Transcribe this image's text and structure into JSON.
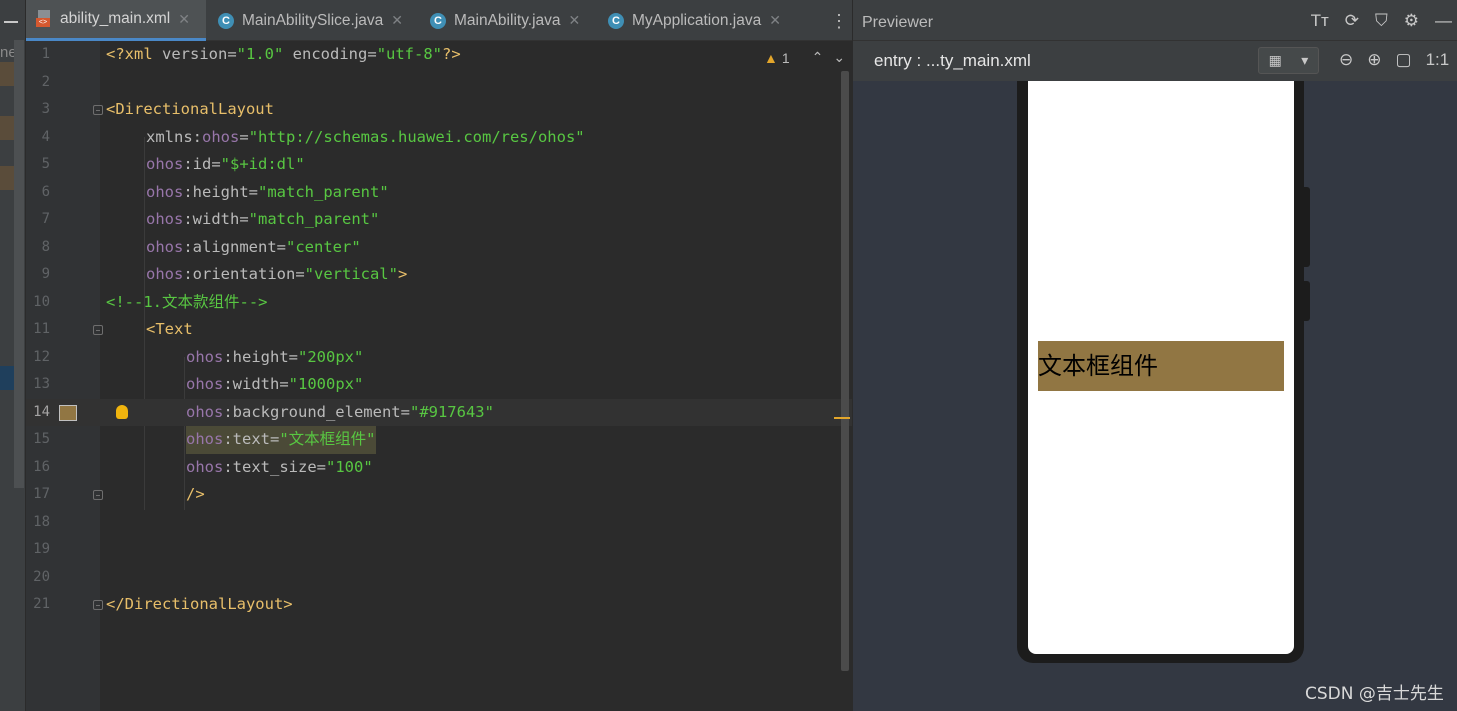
{
  "left_strip": {
    "cut_text": "ner"
  },
  "tabs": [
    {
      "label": "ability_main.xml",
      "icon": "xml-file-icon",
      "active": true
    },
    {
      "label": "MainAbilitySlice.java",
      "icon": "class-icon",
      "active": false
    },
    {
      "label": "MainAbility.java",
      "icon": "class-icon",
      "active": false
    },
    {
      "label": "MyApplication.java",
      "icon": "class-icon",
      "active": false
    }
  ],
  "tab_close": "✕",
  "more_menu": "⋮",
  "inspection": {
    "warnings": "1"
  },
  "line_numbers": [
    "1",
    "2",
    "3",
    "4",
    "5",
    "6",
    "7",
    "8",
    "9",
    "10",
    "11",
    "12",
    "13",
    "14",
    "15",
    "16",
    "17",
    "18",
    "19",
    "20",
    "21"
  ],
  "code": {
    "l1_a": "<?xml ",
    "l1_b": "version",
    "l1_c": "=",
    "l1_d": "\"1.0\"",
    "l1_e": " encoding",
    "l1_f": "=",
    "l1_g": "\"utf-8\"",
    "l1_h": "?>",
    "l3": "<DirectionalLayout",
    "l4_a": "xmlns",
    "l4_b": ":",
    "l4_c": "ohos",
    "l4_d": "=",
    "l4_e": "\"http://schemas.huawei.com/res/ohos\"",
    "ns": "ohos",
    "l5_b": ":id",
    "l5_c": "=",
    "l5_d": "\"$+id:dl\"",
    "l6_b": ":height",
    "l6_c": "=",
    "l6_d": "\"match_parent\"",
    "l7_b": ":width",
    "l7_c": "=",
    "l7_d": "\"match_parent\"",
    "l8_b": ":alignment",
    "l8_c": "=",
    "l8_d": "\"center\"",
    "l9_b": ":orientation",
    "l9_c": "=",
    "l9_d": "\"vertical\"",
    "l9_e": ">",
    "l10": "<!--1.文本款组件-->",
    "l11": "<Text",
    "l12_b": ":height",
    "l12_c": "=",
    "l12_d": "\"200px\"",
    "l13_b": ":width",
    "l13_c": "=",
    "l13_d": "\"1000px\"",
    "l14_b": ":background_element",
    "l14_c": "=",
    "l14_d": "\"#917643\"",
    "l15_b": ":text",
    "l15_c": "=",
    "l15_d": "\"文本框组件\"",
    "l16_b": ":text_size",
    "l16_c": "=",
    "l16_d": "\"100\"",
    "l17": "/>",
    "l21": "</DirectionalLayout>"
  },
  "colors": {
    "swatch": "#917643",
    "accent": "#4a88c7",
    "warning": "#e3a62b"
  },
  "previewer": {
    "title": "Previewer",
    "tools": [
      "Tт",
      "⟳",
      "⛉",
      "⚙",
      "—"
    ],
    "entry_label": "entry : ...ty_main.xml",
    "view_toggle": [
      "▦",
      "▾"
    ],
    "zoom_tools": [
      "⊖",
      "⊕",
      "▢",
      "1:1"
    ],
    "preview_text": "文本框组件"
  },
  "watermark": "CSDN @吉士先生"
}
